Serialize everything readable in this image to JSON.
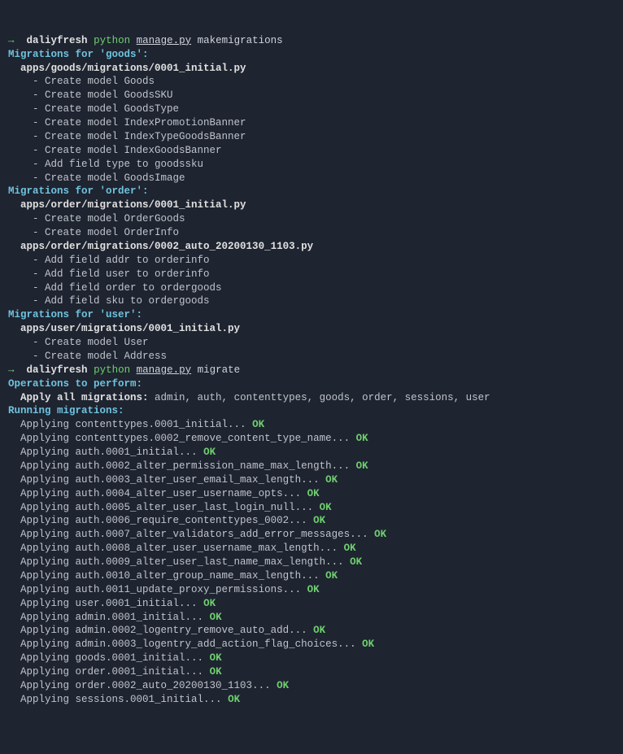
{
  "prompt1": {
    "arrow": "→",
    "env": "daliyfresh",
    "py": "python",
    "script": "manage.py",
    "arg": "makemigrations"
  },
  "goods": {
    "header": "Migrations for 'goods':",
    "file": "apps/goods/migrations/0001_initial.py",
    "items": [
      "- Create model Goods",
      "- Create model GoodsSKU",
      "- Create model GoodsType",
      "- Create model IndexPromotionBanner",
      "- Create model IndexTypeGoodsBanner",
      "- Create model IndexGoodsBanner",
      "- Add field type to goodssku",
      "- Create model GoodsImage"
    ]
  },
  "order": {
    "header": "Migrations for 'order':",
    "file1": "apps/order/migrations/0001_initial.py",
    "items1": [
      "- Create model OrderGoods",
      "- Create model OrderInfo"
    ],
    "file2": "apps/order/migrations/0002_auto_20200130_1103.py",
    "items2": [
      "- Add field addr to orderinfo",
      "- Add field user to orderinfo",
      "- Add field order to ordergoods",
      "- Add field sku to ordergoods"
    ]
  },
  "user": {
    "header": "Migrations for 'user':",
    "file": "apps/user/migrations/0001_initial.py",
    "items": [
      "- Create model User",
      "- Create model Address"
    ]
  },
  "prompt2": {
    "arrow": "→",
    "env": "daliyfresh",
    "py": "python",
    "script": "manage.py",
    "arg": "migrate"
  },
  "ops": {
    "header": "Operations to perform:",
    "apply_label": "Apply all migrations:",
    "apply_list": " admin, auth, contenttypes, goods, order, sessions, user"
  },
  "run": {
    "header": "Running migrations:",
    "lines": [
      "Applying contenttypes.0001_initial...",
      "Applying contenttypes.0002_remove_content_type_name...",
      "Applying auth.0001_initial...",
      "Applying auth.0002_alter_permission_name_max_length...",
      "Applying auth.0003_alter_user_email_max_length...",
      "Applying auth.0004_alter_user_username_opts...",
      "Applying auth.0005_alter_user_last_login_null...",
      "Applying auth.0006_require_contenttypes_0002...",
      "Applying auth.0007_alter_validators_add_error_messages...",
      "Applying auth.0008_alter_user_username_max_length...",
      "Applying auth.0009_alter_user_last_name_max_length...",
      "Applying auth.0010_alter_group_name_max_length...",
      "Applying auth.0011_update_proxy_permissions...",
      "Applying user.0001_initial...",
      "Applying admin.0001_initial...",
      "Applying admin.0002_logentry_remove_auto_add...",
      "Applying admin.0003_logentry_add_action_flag_choices...",
      "Applying goods.0001_initial...",
      "Applying order.0001_initial...",
      "Applying order.0002_auto_20200130_1103...",
      "Applying sessions.0001_initial..."
    ],
    "ok": " OK"
  }
}
